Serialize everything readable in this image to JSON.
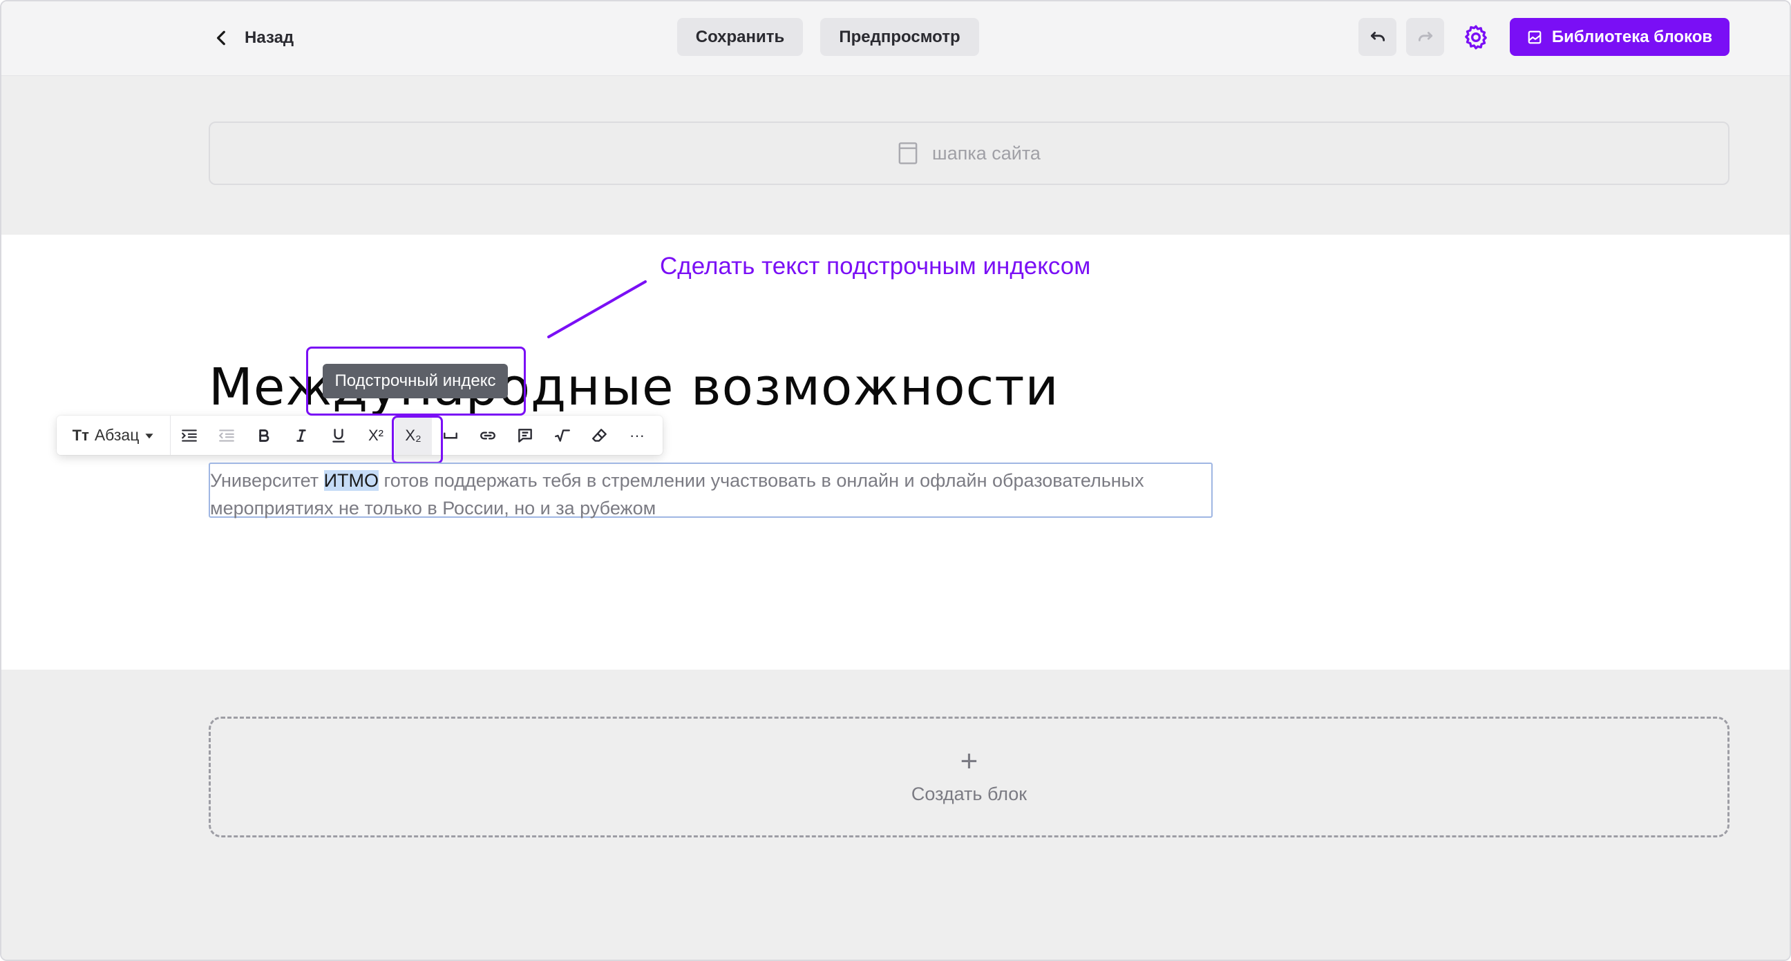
{
  "topbar": {
    "back_label": "Назад",
    "save_label": "Сохранить",
    "preview_label": "Предпросмотр",
    "library_label": "Библиотека блоков",
    "accent_color": "#7a0ff5"
  },
  "header": {
    "placeholder_label": "шапка сайта"
  },
  "content": {
    "annotation": "Сделать текст подстрочным индексом",
    "heading": "Международные возможности",
    "tooltip": "Подстрочный индекс",
    "paragraph": {
      "before": "Университет ",
      "selected": "ИТМО",
      "after": " готов поддержать тебя в стремлении участвовать в онлайн и офлайн образовательных мероприятиях не только в России, но и за рубежом"
    }
  },
  "toolbar": {
    "format_icon": "Tт",
    "format_label": "Абзац",
    "superscript_label": "X²",
    "subscript_label": "X₂",
    "more_label": "···"
  },
  "footer": {
    "create_label": "Создать блок",
    "plus_icon": "+"
  }
}
